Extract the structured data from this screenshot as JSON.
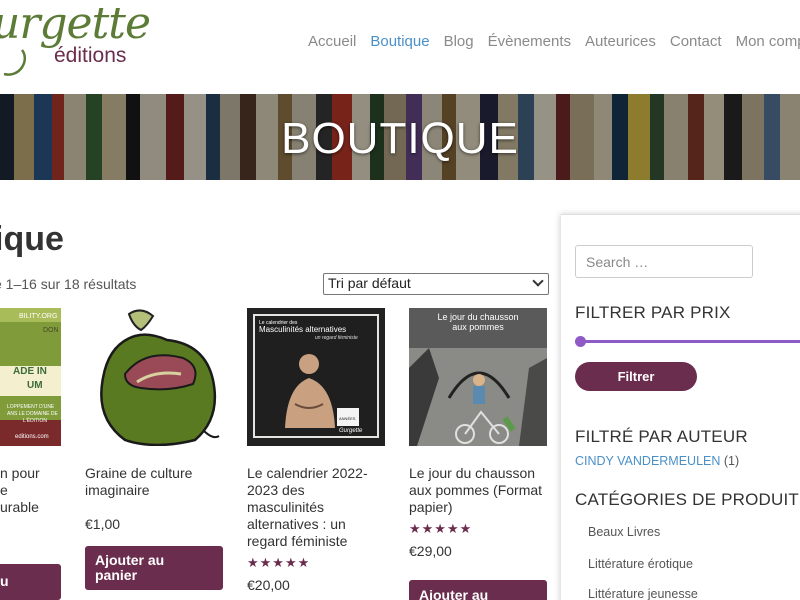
{
  "header": {
    "logo_word": "urgette",
    "logo_sub": "éditions",
    "nav": [
      "Accueil",
      "Boutique",
      "Blog",
      "Évènements",
      "Auteurices",
      "Contact",
      "Mon compte"
    ]
  },
  "banner": {
    "title": "BOUTIQUE"
  },
  "main": {
    "title": "ique",
    "result_count": "e 1–16 sur 18 résultats",
    "sort_selected": "Tri par défaut",
    "products": [
      {
        "name_lines": [
          "n pour",
          "e",
          "urable"
        ],
        "price": "",
        "button_lines": [
          "u"
        ]
      },
      {
        "name_lines": [
          "Graine de culture",
          "imaginaire"
        ],
        "price": "€1,00",
        "button_lines": [
          "Ajouter au",
          "panier"
        ]
      },
      {
        "name_lines": [
          "Le calendrier 2022-",
          "2023 des",
          "masculinités",
          "alternatives : un",
          "regard féministe"
        ],
        "stars": "★★★★★",
        "price": "€20,00"
      },
      {
        "name_lines": [
          "Le jour du chausson",
          "aux pommes (Format",
          "papier)"
        ],
        "stars": "★★★★★",
        "price": "€29,00",
        "button_lines": [
          "Ajouter au"
        ]
      }
    ],
    "cover_texts": {
      "p1_lines": [
        "BILITY.ORG",
        "DON",
        "ADE IN",
        "UM",
        "LOPPEMENT D'UNE",
        "ANS LE DOMAINE DE",
        "L'ÉDITION",
        "editions.com"
      ],
      "p3_lines": [
        "Le calendrier des",
        "Masculinités alternatives",
        "un regard féministe",
        "ANNÉES",
        "Gurgette"
      ],
      "p4_lines": [
        "Le jour du chausson",
        "aux pommes"
      ]
    }
  },
  "sidebar": {
    "search_placeholder": "Search …",
    "price_title": "FILTRER PAR PRIX",
    "filter_button": "Filtrer",
    "author_title": "FILTRÉ PAR AUTEUR",
    "author_name": "CINDY VANDERMEULEN",
    "author_count": "(1)",
    "categories_title": "CATÉGORIES DE PRODUITS",
    "categories": [
      "Beaux Livres",
      "Littérature érotique",
      "Littérature jeunesse"
    ]
  },
  "colors": {
    "brand": "#6b2d4d",
    "logo_green": "#5b7b36",
    "link_blue": "#4a90c8",
    "slider_purple": "#8e5ac6"
  }
}
